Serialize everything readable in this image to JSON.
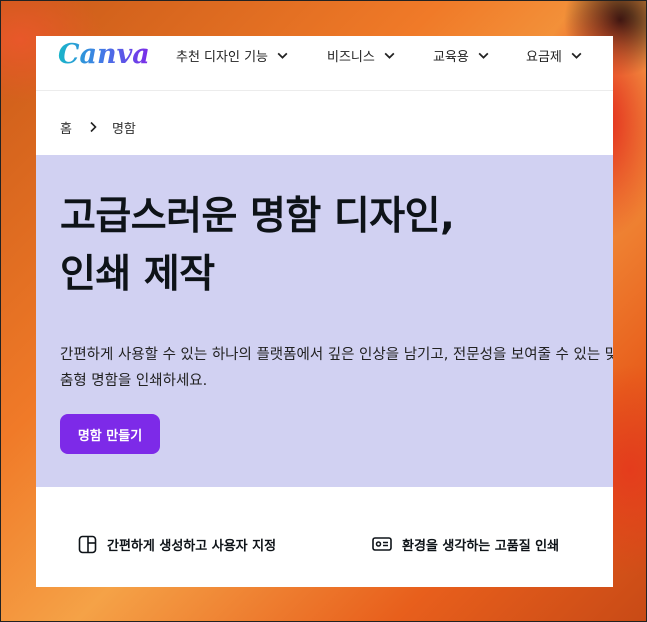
{
  "nav": {
    "logo": "Canva",
    "items": [
      {
        "label": "추천 디자인 기능"
      },
      {
        "label": "비즈니스"
      },
      {
        "label": "교육용"
      },
      {
        "label": "요금제"
      }
    ]
  },
  "breadcrumb": {
    "home": "홈",
    "current": "명함"
  },
  "hero": {
    "title_line1": "고급스러운 명함 디자인,",
    "title_line2": "인쇄 제작",
    "description": "간편하게 사용할 수 있는 하나의 플랫폼에서 깊은 인상을 남기고, 전문성을 보여줄 수 있는 맞춤형 명함을 인쇄하세요.",
    "cta": "명함 만들기"
  },
  "features": [
    {
      "label": "간편하게 생성하고 사용자 지정",
      "icon": "layout-panel-icon"
    },
    {
      "label": "환경을 생각하는 고품질 인쇄",
      "icon": "id-card-icon"
    }
  ],
  "colors": {
    "brand_purple": "#7d2ae8",
    "hero_background": "#d1d1f2",
    "text_dark": "#0e1318"
  }
}
